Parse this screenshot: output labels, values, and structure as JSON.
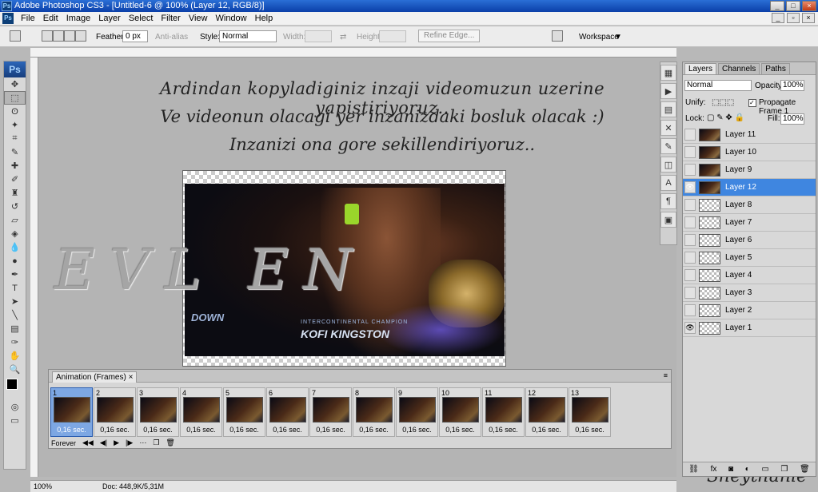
{
  "window": {
    "title": "Adobe Photoshop CS3 - [Untitled-6 @ 100% (Layer 12, RGB/8)]",
    "app_icon": "Ps"
  },
  "menu": [
    "File",
    "Edit",
    "Image",
    "Layer",
    "Select",
    "Filter",
    "View",
    "Window",
    "Help"
  ],
  "options": {
    "feather_label": "Feather:",
    "feather_value": "0 px",
    "antialias_label": "Anti-alias",
    "style_label": "Style:",
    "style_value": "Normal",
    "width_label": "Width:",
    "height_label": "Height:",
    "refine_edge": "Refine Edge...",
    "workspace": "Workspace"
  },
  "toolbar": {
    "logo": "Ps"
  },
  "canvas": {
    "caption_line1": "Ardindan kopyladiginiz inzaji videomuzun uzerine yapistiriyoruz..",
    "caption_line2": "Ve videonun olacagi yer inzanizdaki bosluk olacak :)",
    "caption_line3": "Inzanizi ona gore sekillendiriyoruz..",
    "watermark": "EVL          EN",
    "photo_logo1": "DOWN",
    "photo_logo2": "INTERCONTINENTAL CHAMPION",
    "photo_logo3": "KOFI KINGSTON",
    "signature": "Sheythanie"
  },
  "animation": {
    "tab_label": "Animation (Frames)",
    "tab_close": "×",
    "frames": [
      {
        "num": "1",
        "dur": "0,16 sec."
      },
      {
        "num": "2",
        "dur": "0,16 sec."
      },
      {
        "num": "3",
        "dur": "0,16 sec."
      },
      {
        "num": "4",
        "dur": "0,16 sec."
      },
      {
        "num": "5",
        "dur": "0,16 sec."
      },
      {
        "num": "6",
        "dur": "0,16 sec."
      },
      {
        "num": "7",
        "dur": "0,16 sec."
      },
      {
        "num": "8",
        "dur": "0,16 sec."
      },
      {
        "num": "9",
        "dur": "0,16 sec."
      },
      {
        "num": "10",
        "dur": "0,16 sec."
      },
      {
        "num": "11",
        "dur": "0,16 sec."
      },
      {
        "num": "12",
        "dur": "0,16 sec."
      },
      {
        "num": "13",
        "dur": "0,16 sec."
      }
    ],
    "loop": "Forever"
  },
  "layers_panel": {
    "tabs": [
      "Layers",
      "Channels",
      "Paths"
    ],
    "blend_mode": "Normal",
    "opacity_label": "Opacity:",
    "opacity_value": "100%",
    "unify_label": "Unify:",
    "propagate_label": "Propagate Frame 1",
    "lock_label": "Lock:",
    "fill_label": "Fill:",
    "fill_value": "100%",
    "layers": [
      "Layer 11",
      "Layer 10",
      "Layer 9",
      "Layer 12",
      "Layer 8",
      "Layer 7",
      "Layer 6",
      "Layer 5",
      "Layer 4",
      "Layer 3",
      "Layer 2",
      "Layer 1"
    ],
    "active_layer": "Layer 12"
  },
  "status": {
    "zoom": "100%",
    "doc": "Doc: 448,9K/5,31M"
  }
}
